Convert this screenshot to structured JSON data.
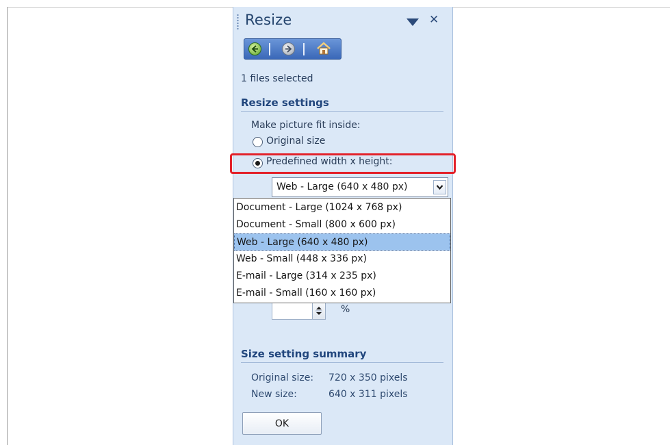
{
  "pane": {
    "title": "Resize",
    "files_selected": "1 files selected"
  },
  "nav": {
    "icons": [
      "back-arrow-icon",
      "forward-arrow-icon",
      "home-icon"
    ]
  },
  "resize_settings": {
    "heading": "Resize settings",
    "fit_label": "Make picture fit inside:",
    "option_original": "Original size",
    "option_predefined": "Predefined width x height:",
    "selected_option": "predefined",
    "select_value": "Web - Large (640 x 480 px)",
    "options": [
      "Document - Large (1024 x 768 px)",
      "Document - Small (800 x 600 px)",
      "Web - Large (640 x 480 px)",
      "Web - Small (448 x 336 px)",
      "E-mail - Large (314 x 235 px)",
      "E-mail - Small (160 x 160 px)"
    ],
    "selected_index": 2,
    "percent_symbol": "%"
  },
  "summary": {
    "heading": "Size setting summary",
    "original_label": "Original size:",
    "original_value": "720 x 350 pixels",
    "new_label": "New size:",
    "new_value": "640 x 311 pixels"
  },
  "ok_label": "OK",
  "colors": {
    "pane_bg": "#dbe8f7",
    "heading": "#21467d",
    "highlight": "#e3212a",
    "selected_item": "#9cc3ee"
  }
}
